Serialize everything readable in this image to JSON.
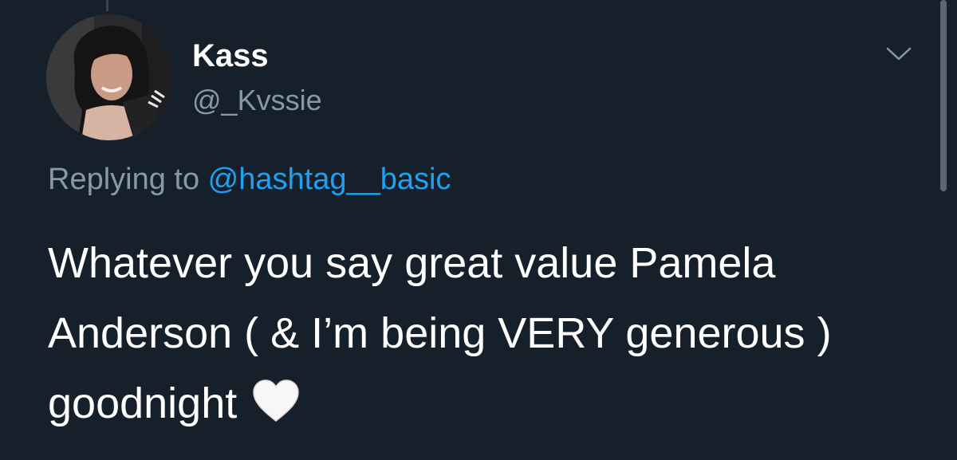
{
  "tweet": {
    "display_name": "Kass",
    "handle": "@_Kvssie",
    "replying_prefix": "Replying to ",
    "replying_to": "@hashtag__basic",
    "text": "Whatever you say great value Pamela Anderson ( & I’m being VERY generous ) goodnight",
    "trailing_emoji": "white-heart-icon"
  },
  "icons": {
    "menu": "chevron-down-icon",
    "avatar": "profile-photo"
  },
  "colors": {
    "background": "#15202b",
    "primary_text": "#ffffff",
    "secondary_text": "#8899a6",
    "link": "#1da1f2"
  }
}
